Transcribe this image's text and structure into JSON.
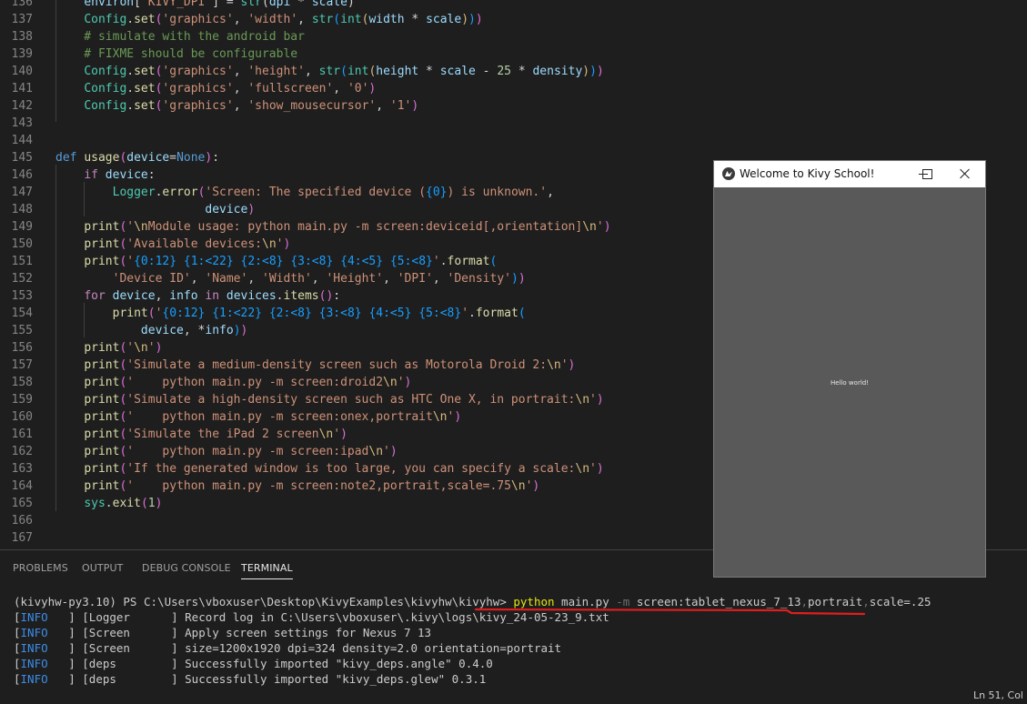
{
  "editor": {
    "line_numbers": [
      "136",
      "137",
      "138",
      "139",
      "140",
      "141",
      "142",
      "143",
      "144",
      "145",
      "146",
      "147",
      "148",
      "149",
      "150",
      "151",
      "152",
      "153",
      "154",
      "155",
      "156",
      "157",
      "158",
      "159",
      "160",
      "161",
      "162",
      "163",
      "164",
      "165",
      "166",
      "167"
    ]
  },
  "panel": {
    "tabs": [
      "PROBLEMS",
      "OUTPUT",
      "DEBUG CONSOLE",
      "TERMINAL"
    ],
    "active_tab": "TERMINAL"
  },
  "terminal": {
    "prompt": "(kivyhw-py3.10) PS C:\\Users\\vboxuser\\Desktop\\KivyExamples\\kivyhw\\kivyhw> ",
    "cmd_python": "python",
    "cmd_rest1": " main.py ",
    "cmd_flag": "-m",
    "cmd_rest2": " screen:tablet_nexus_7_13",
    "cmd_comma1": ",",
    "cmd_rest3": "portrait",
    "cmd_comma2": ",",
    "cmd_rest4": "scale=.25",
    "log_lines": [
      {
        "tag": "INFO",
        "mod": "   ] [Logger      ] ",
        "msg": "Record log in C:\\Users\\vboxuser\\.kivy\\logs\\kivy_24-05-23_9.txt"
      },
      {
        "tag": "INFO",
        "mod": "   ] [Screen      ] ",
        "msg": "Apply screen settings for Nexus 7 13"
      },
      {
        "tag": "INFO",
        "mod": "   ] [Screen      ] ",
        "msg": "size=1200x1920 dpi=324 density=2.0 orientation=portrait"
      },
      {
        "tag": "INFO",
        "mod": "   ] [deps        ] ",
        "msg": "Successfully imported \"kivy_deps.angle\" 0.4.0"
      },
      {
        "tag": "INFO",
        "mod": "   ] [deps        ] ",
        "msg": "Successfully imported \"kivy_deps.glew\" 0.3.1"
      }
    ]
  },
  "status": {
    "cursor": "Ln 51, Col"
  },
  "kivy_window": {
    "title": "Welcome to Kivy School!",
    "label": "Hello world!"
  }
}
